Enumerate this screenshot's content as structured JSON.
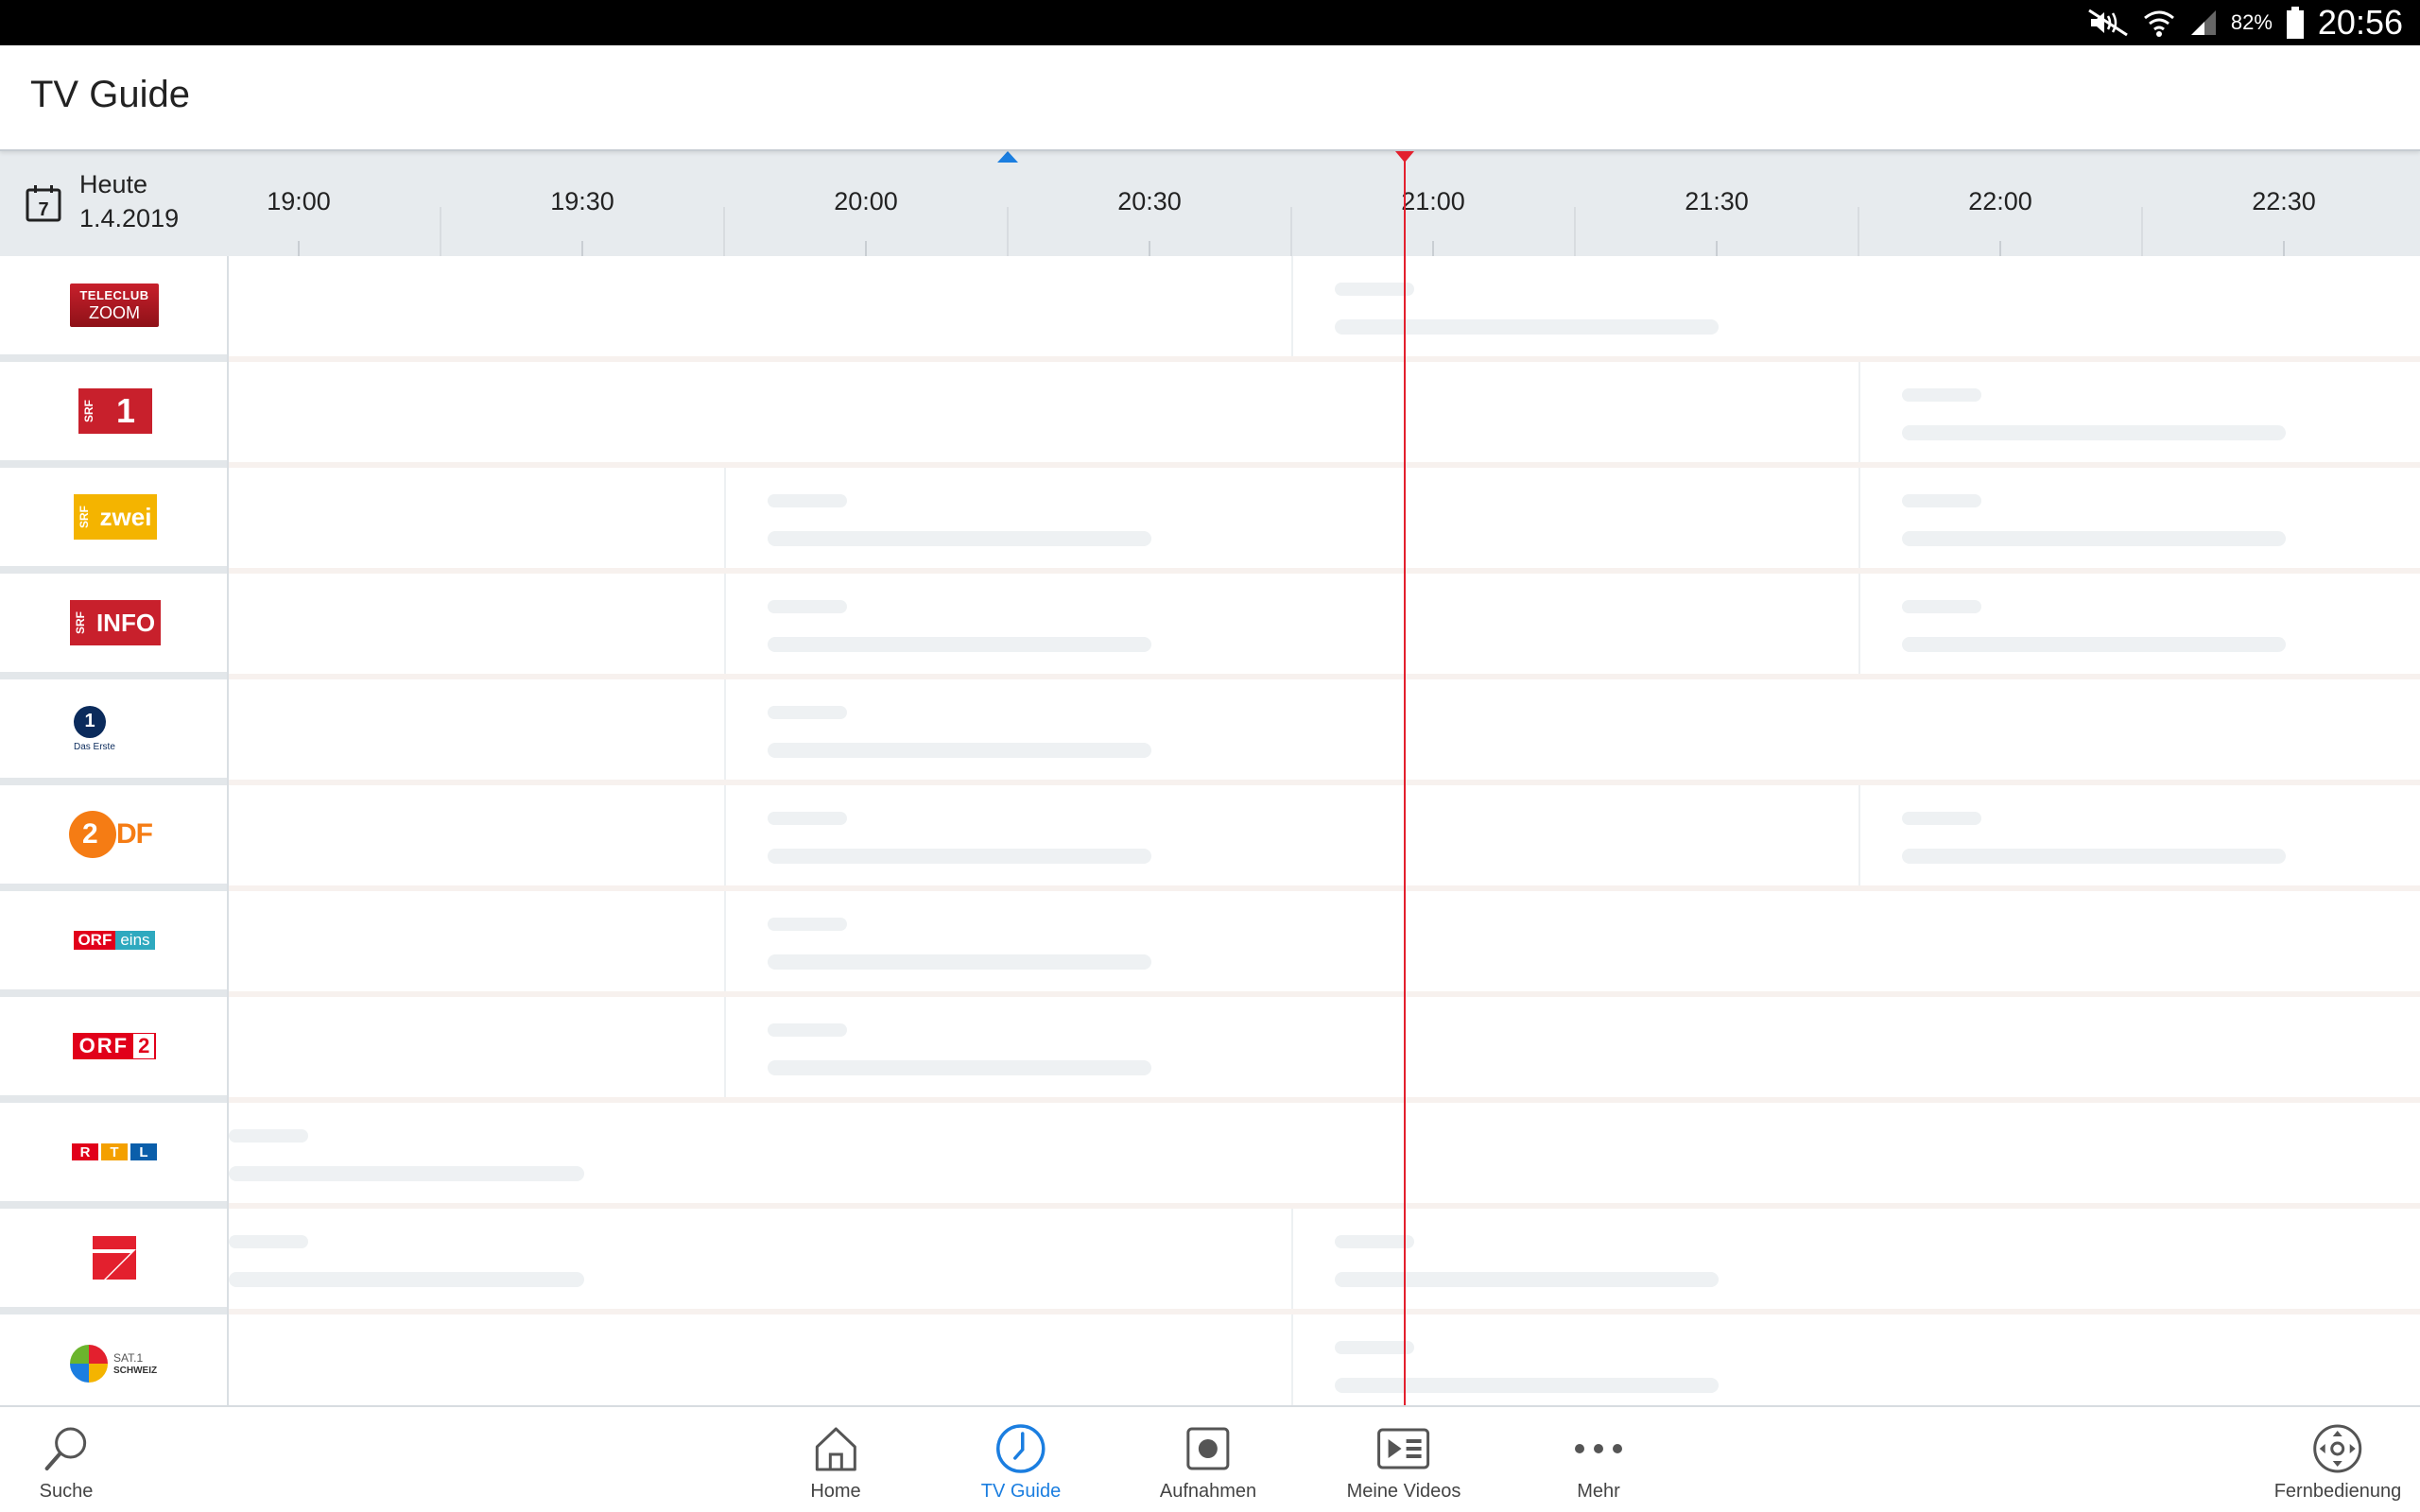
{
  "status_bar": {
    "battery_percent": "82%",
    "time": "20:56"
  },
  "app": {
    "title": "TV Guide"
  },
  "date_selector": {
    "day_label": "Heute",
    "date": "1.4.2019"
  },
  "timeline": {
    "ticks": [
      "19:00",
      "19:30",
      "20:00",
      "20:30",
      "21:00",
      "21:30",
      "22:00",
      "22:30"
    ],
    "now_time": "20:56"
  },
  "channels": [
    {
      "name": "Teleclub Zoom",
      "logo_text": [
        "TELECLUB",
        "ZOOM"
      ]
    },
    {
      "name": "SRF 1",
      "logo_text": [
        "SRF",
        "1"
      ]
    },
    {
      "name": "SRF zwei",
      "logo_text": [
        "SRF",
        "zwei"
      ]
    },
    {
      "name": "SRF info",
      "logo_text": [
        "SRF",
        "INFO"
      ]
    },
    {
      "name": "Das Erste",
      "logo_text": [
        "1",
        "Das Erste"
      ]
    },
    {
      "name": "ZDF",
      "logo_text": [
        "2",
        "DF"
      ]
    },
    {
      "name": "ORF eins",
      "logo_text": [
        "ORF",
        "eins"
      ]
    },
    {
      "name": "ORF 2",
      "logo_text": [
        "ORF",
        "2"
      ]
    },
    {
      "name": "RTL",
      "logo_text": [
        "R",
        "T",
        "L"
      ]
    },
    {
      "name": "ProSieben",
      "logo_text": []
    },
    {
      "name": "SAT.1 Schweiz",
      "logo_text": [
        "SAT.1",
        "SCHWEIZ"
      ]
    }
  ],
  "nav": {
    "items": [
      {
        "label": "Suche",
        "icon": "search-icon"
      },
      {
        "label": "Home",
        "icon": "home-icon"
      },
      {
        "label": "TV Guide",
        "icon": "clock-icon",
        "active": true
      },
      {
        "label": "Aufnahmen",
        "icon": "record-icon"
      },
      {
        "label": "Meine Videos",
        "icon": "videos-icon"
      },
      {
        "label": "Mehr",
        "icon": "more-icon"
      },
      {
        "label": "Fernbedienung",
        "icon": "remote-icon"
      }
    ]
  },
  "colors": {
    "accent": "#1b7ee0",
    "now_line": "#e3202e",
    "header_bg": "#e7ebee",
    "skeleton": "#eef1f3"
  }
}
